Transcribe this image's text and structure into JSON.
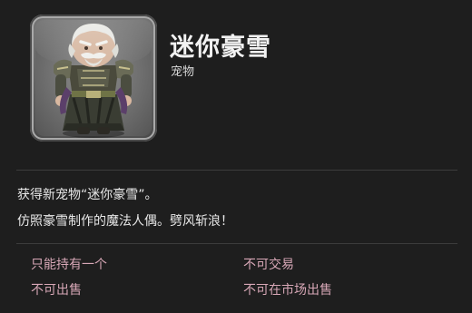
{
  "item": {
    "name": "迷你豪雪",
    "category": "宠物",
    "icon": "minion-portrait-icon"
  },
  "description": {
    "line1": "获得新宠物“迷你豪雪”。",
    "line2": "仿照豪雪制作的魔法人偶。劈风斩浪！"
  },
  "restrictions": {
    "unique": "只能持有一个",
    "untradable": "不可交易",
    "unsellable": "不可出售",
    "no_market": "不可在市场出售"
  },
  "colors": {
    "background": "#1e1e1e",
    "restriction_text": "#d7a7b6",
    "divider": "#3c3c3c"
  }
}
